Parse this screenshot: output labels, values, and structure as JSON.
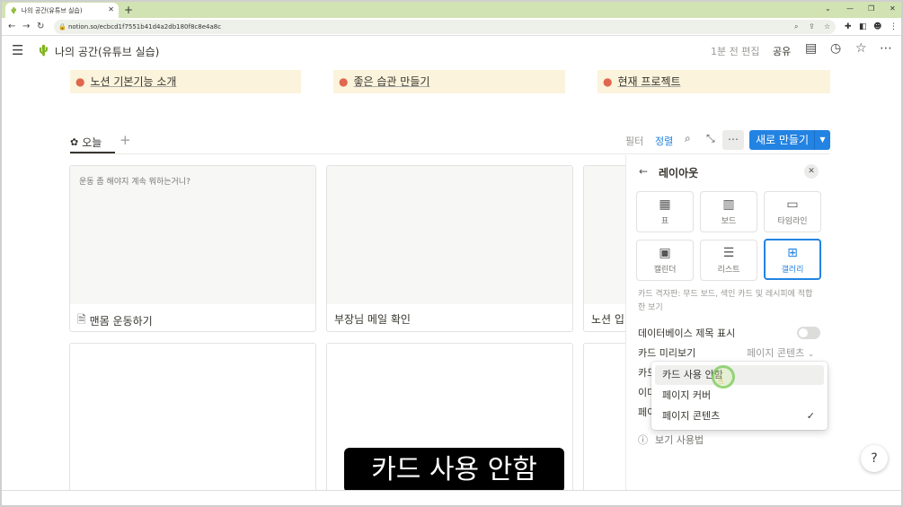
{
  "browser": {
    "tab_title": "나의 공간(유튜브 실습)",
    "url": "notion.so/ecbcd1f7551b41d4a2db180f8c8e4a8c"
  },
  "topbar": {
    "page_title": "나의 공간(유튜브 실습)",
    "edited": "1분 전 편집",
    "share": "공유"
  },
  "callouts": [
    "노션 기본기능 소개",
    "좋은 습관 만들기",
    "현재 프로젝트"
  ],
  "view": {
    "tab_label": "오늘",
    "filter": "필터",
    "sort": "정렬",
    "new_button": "새로 만들기"
  },
  "cards": [
    {
      "preview": "운동 좀 해야지 계속 뭐하는거니?",
      "name": "맨몸 운동하기"
    },
    {
      "preview": "",
      "name": "부장님 메일 확인"
    },
    {
      "preview": "",
      "name": "노션 입"
    }
  ],
  "panel": {
    "title": "레이아웃",
    "layouts": [
      "표",
      "보드",
      "타임라인",
      "캘린더",
      "리스트",
      "갤러리"
    ],
    "description": "카드 격자판: 무드 보드, 색인 카드 및 레시피에 적합한 보기",
    "show_db_title": "데이터베이스 제목 표시",
    "card_preview": "카드 미리보기",
    "card_preview_value": "페이지 콘텐츠",
    "row_card": "카드",
    "row_image": "이미",
    "row_page": "페이",
    "help": "보기 사용법"
  },
  "dropdown": {
    "options": [
      "카드 사용 안함",
      "페이지 커버",
      "페이지 콘텐츠"
    ],
    "selected_index": 2
  },
  "caption": "카드 사용 안함"
}
